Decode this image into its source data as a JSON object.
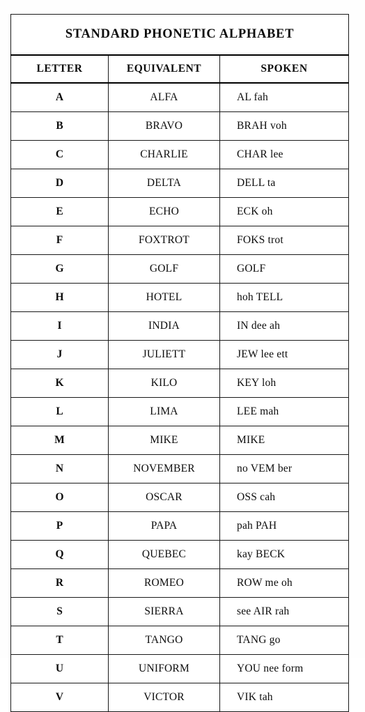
{
  "document": {
    "title": "STANDARD PHONETIC ALPHABET"
  },
  "table": {
    "columns": [
      {
        "key": "letter",
        "label": "LETTER",
        "align": "center"
      },
      {
        "key": "equivalent",
        "label": "EQUIVALENT",
        "align": "center"
      },
      {
        "key": "spoken",
        "label": "SPOKEN",
        "align": "left"
      }
    ],
    "rows": [
      {
        "letter": "A",
        "equivalent": "ALFA",
        "spoken": "AL fah"
      },
      {
        "letter": "B",
        "equivalent": "BRAVO",
        "spoken": "BRAH voh"
      },
      {
        "letter": "C",
        "equivalent": "CHARLIE",
        "spoken": "CHAR lee"
      },
      {
        "letter": "D",
        "equivalent": "DELTA",
        "spoken": "DELL ta"
      },
      {
        "letter": "E",
        "equivalent": "ECHO",
        "spoken": "ECK oh"
      },
      {
        "letter": "F",
        "equivalent": "FOXTROT",
        "spoken": "FOKS trot"
      },
      {
        "letter": "G",
        "equivalent": "GOLF",
        "spoken": "GOLF"
      },
      {
        "letter": "H",
        "equivalent": "HOTEL",
        "spoken": "hoh TELL"
      },
      {
        "letter": "I",
        "equivalent": "INDIA",
        "spoken": "IN dee ah"
      },
      {
        "letter": "J",
        "equivalent": "JULIETT",
        "spoken": "JEW lee ett"
      },
      {
        "letter": "K",
        "equivalent": "KILO",
        "spoken": "KEY loh"
      },
      {
        "letter": "L",
        "equivalent": "LIMA",
        "spoken": "LEE mah"
      },
      {
        "letter": "M",
        "equivalent": "MIKE",
        "spoken": "MIKE"
      },
      {
        "letter": "N",
        "equivalent": "NOVEMBER",
        "spoken": "no VEM ber"
      },
      {
        "letter": "O",
        "equivalent": "OSCAR",
        "spoken": "OSS cah"
      },
      {
        "letter": "P",
        "equivalent": "PAPA",
        "spoken": "pah PAH"
      },
      {
        "letter": "Q",
        "equivalent": "QUEBEC",
        "spoken": "kay BECK"
      },
      {
        "letter": "R",
        "equivalent": "ROMEO",
        "spoken": "ROW me oh"
      },
      {
        "letter": "S",
        "equivalent": "SIERRA",
        "spoken": "see AIR rah"
      },
      {
        "letter": "T",
        "equivalent": "TANGO",
        "spoken": "TANG go"
      },
      {
        "letter": "U",
        "equivalent": "UNIFORM",
        "spoken": "YOU nee form"
      },
      {
        "letter": "V",
        "equivalent": "VICTOR",
        "spoken": "VIK tah"
      }
    ]
  }
}
